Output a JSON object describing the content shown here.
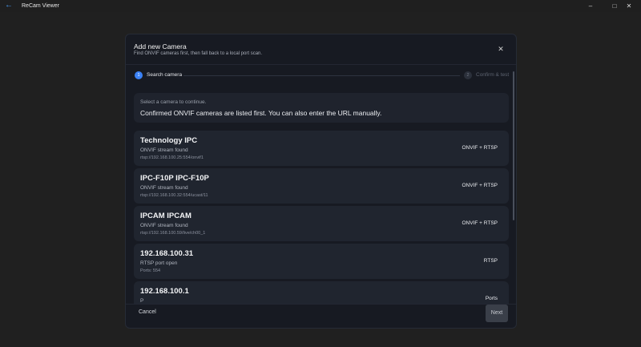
{
  "window": {
    "title": "ReCam Viewer",
    "back_icon": "arrow-left-icon",
    "minimize": "–",
    "maximize": "□",
    "close": "✕"
  },
  "dialog": {
    "title": "Add new Camera",
    "subtitle": "Find ONVIF cameras first, then fall back to a local port scan.",
    "close_icon": "✕",
    "steps": [
      {
        "number": "1",
        "label": "Search camera",
        "active": true
      },
      {
        "number": "2",
        "label": "Confirm & test",
        "active": false
      }
    ],
    "info": {
      "hint": "Select a camera to continue.",
      "message": "Confirmed ONVIF cameras are listed first. You can also enter the URL manually."
    },
    "cameras": [
      {
        "name": "Technology IPC",
        "status": "ONVIF stream found",
        "detail": "rtsp://192.168.100.25:554/onvif1",
        "protocol": "ONVIF + RTSP"
      },
      {
        "name": "IPC-F10P IPC-F10P",
        "status": "ONVIF stream found",
        "detail": "rtsp://192.168.100.32:554/ucast/11",
        "protocol": "ONVIF + RTSP"
      },
      {
        "name": "IPCAM IPCAM",
        "status": "ONVIF stream found",
        "detail": "rtsp://192.168.100.59/live/ch00_1",
        "protocol": "ONVIF + RTSP"
      },
      {
        "name": "192.168.100.31",
        "status": "RTSP port open",
        "detail": "Ports: 554",
        "protocol": "RTSP"
      },
      {
        "name": "192.168.100.1",
        "status": "P",
        "detail": "",
        "protocol": "Ports"
      }
    ],
    "footer": {
      "cancel_label": "Cancel",
      "next_label": "Next"
    }
  },
  "colors": {
    "accent": "#3b82f6",
    "dialog_bg": "#171a22",
    "card_bg": "#20252f"
  }
}
